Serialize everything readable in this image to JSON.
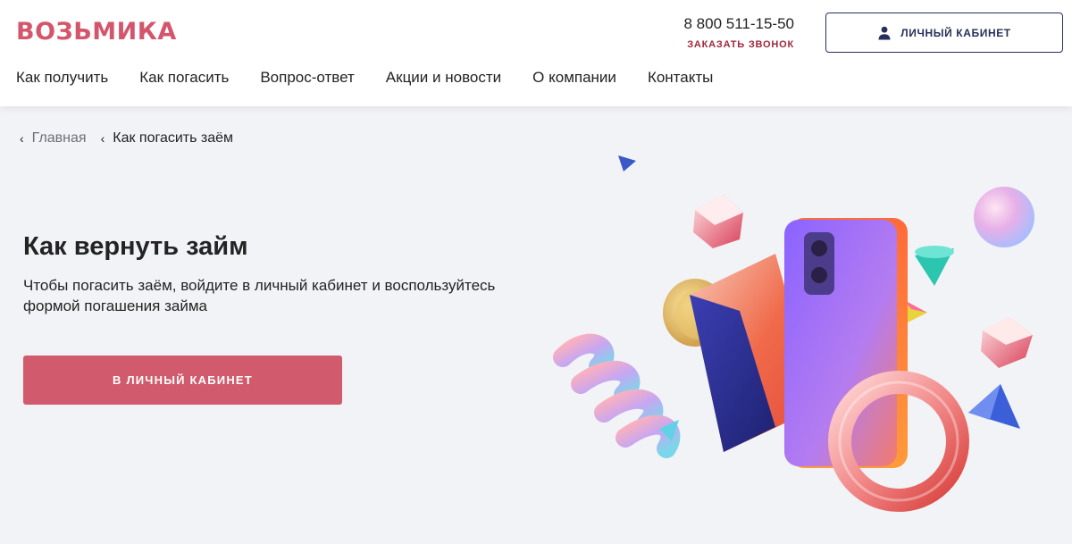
{
  "brand": {
    "logo_text": "ВОЗЬМИКА",
    "accent": "#d4566c",
    "dark": "#27305a"
  },
  "header": {
    "phone": "8 800 511-15-50",
    "callback_label": "ЗАКАЗАТЬ ЗВОНОК",
    "cabinet_label": "ЛИЧНЫЙ КАБИНЕТ",
    "cabinet_icon": "user-icon"
  },
  "nav": {
    "items": [
      {
        "label": "Как получить"
      },
      {
        "label": "Как погасить"
      },
      {
        "label": "Вопрос-ответ"
      },
      {
        "label": "Акции и новости"
      },
      {
        "label": "О компании"
      },
      {
        "label": "Контакты"
      }
    ]
  },
  "breadcrumb": {
    "home": "Главная",
    "current": "Как погасить заём"
  },
  "hero": {
    "title": "Как вернуть займ",
    "text": "Чтобы погасить заём, войдите в личный кабинет и воспользуйтесь формой погашения займа",
    "cta_label": "В ЛИЧНЫЙ КАБИНЕТ"
  }
}
